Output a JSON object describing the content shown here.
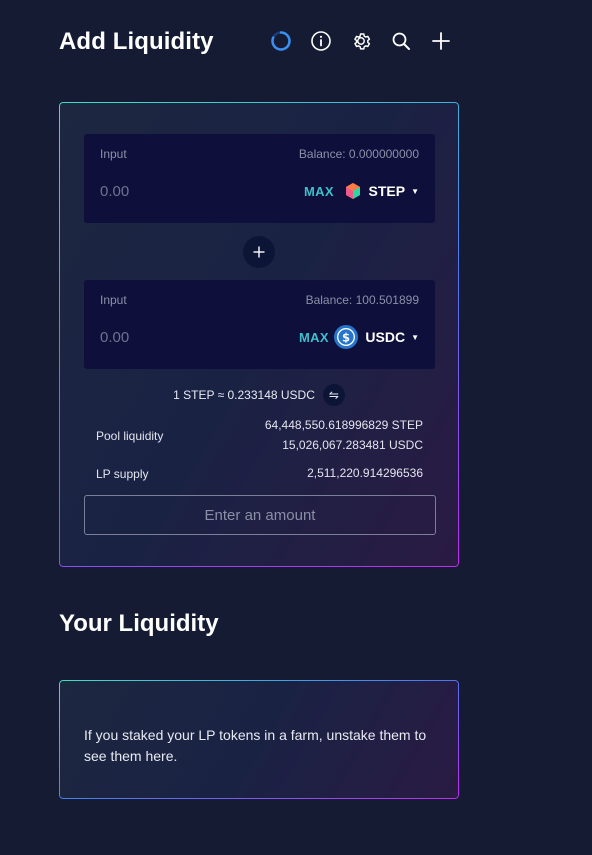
{
  "header": {
    "title": "Add Liquidity",
    "icons": [
      "loading-ring-icon",
      "info-icon",
      "gear-icon",
      "search-icon",
      "plus-icon"
    ]
  },
  "input1": {
    "label": "Input",
    "balance": "Balance: 0.000000000",
    "placeholder": "0.00",
    "max_label": "MAX",
    "token": "STEP"
  },
  "input2": {
    "label": "Input",
    "balance": "Balance: 100.501899",
    "placeholder": "0.00",
    "max_label": "MAX",
    "token": "USDC"
  },
  "rate": "1 STEP ≈ 0.233148 USDC",
  "pool": {
    "liquidity_label": "Pool liquidity",
    "liquidity_step": "64,448,550.618996829 STEP",
    "liquidity_usdc": "15,026,067.283481 USDC",
    "supply_label": "LP supply",
    "supply_value": "2,511,220.914296536"
  },
  "action_button": "Enter an amount",
  "your_liquidity": {
    "title": "Your Liquidity",
    "hint": "If you staked your LP tokens in a farm, unstake them to see them here."
  },
  "colors": {
    "background": "#141b32",
    "accent_teal": "#3fbfca",
    "border_start": "#3ee0c4",
    "border_end": "#c02cf0",
    "usdc_blue": "#2775ca"
  }
}
